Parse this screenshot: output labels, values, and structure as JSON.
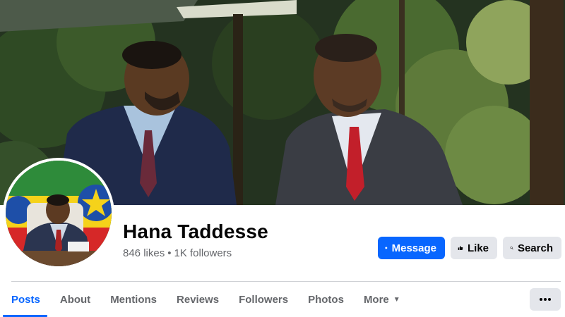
{
  "profile": {
    "name": "Hana Taddesse",
    "likes": "846 likes",
    "separator": "•",
    "followers": "1K followers"
  },
  "actions": {
    "message": "Message",
    "like": "Like",
    "search": "Search"
  },
  "tabs": [
    {
      "label": "Posts",
      "active": true
    },
    {
      "label": "About",
      "active": false
    },
    {
      "label": "Mentions",
      "active": false
    },
    {
      "label": "Reviews",
      "active": false
    },
    {
      "label": "Followers",
      "active": false
    },
    {
      "label": "Photos",
      "active": false
    },
    {
      "label": "More",
      "active": false
    }
  ],
  "more_menu_icon": "ellipsis-icon",
  "icons": {
    "message": "messenger-icon",
    "like": "thumbs-up-icon",
    "search": "search-icon",
    "more_tab": "caret-down-icon"
  },
  "colors": {
    "accent": "#0866ff",
    "secondary_button": "#e4e6eb",
    "muted_text": "#65676b"
  }
}
